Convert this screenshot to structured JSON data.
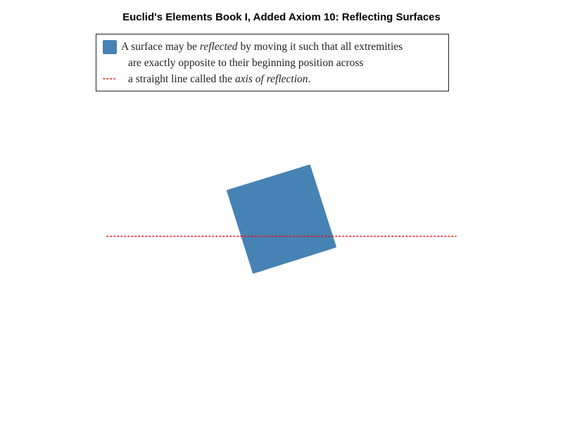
{
  "title": "Euclid's Elements Book I, Added Axiom 10: Reflecting Surfaces",
  "legend": {
    "line1_pre": "A surface may be ",
    "line1_em": "reflected",
    "line1_post": " by moving it such that all extremities",
    "line2": "are exactly opposite to their beginning position across",
    "line3_pre": "a straight line called the ",
    "line3_em": "axis of reflection",
    "line3_post": "."
  },
  "colors": {
    "surface": "#4682b4",
    "axis": "#ff0000",
    "legend_border": "#222222"
  }
}
